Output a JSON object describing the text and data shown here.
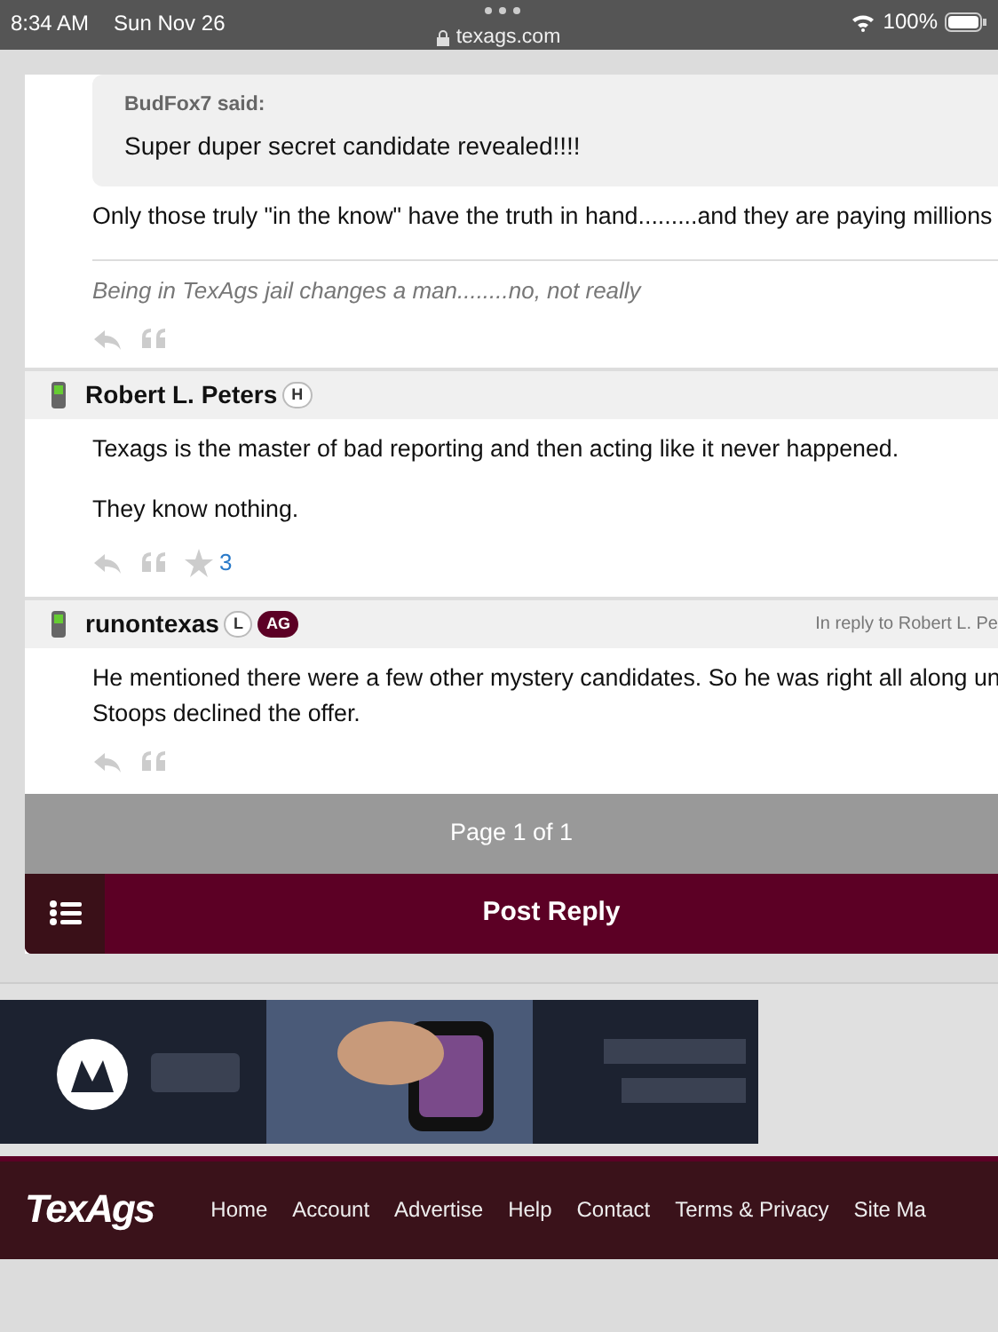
{
  "status_bar": {
    "time": "8:34 AM",
    "date": "Sun Nov 26",
    "url": "texags.com",
    "battery": "100%"
  },
  "first_post": {
    "quote": {
      "author": "BudFox7 said:",
      "text": "Super duper secret candidate revealed!!!!"
    },
    "body": [
      "Only those truly \"in the know\" have the truth in hand.........and they are paying millions"
    ],
    "signature": "Being in TexAgs jail changes a man........no, not really"
  },
  "posts": [
    {
      "author": "Robert L. Peters",
      "badges": [
        {
          "label": "H",
          "kind": "outline"
        }
      ],
      "body": [
        "Texags is the master of bad reporting and then acting like it never happened.",
        "They know nothing."
      ],
      "stars": "3"
    },
    {
      "author": "runontexas",
      "badges": [
        {
          "label": "L",
          "kind": "outline"
        },
        {
          "label": "AG",
          "kind": "filled"
        }
      ],
      "reply_to": "In reply to Robert L. Pe",
      "body": [
        "He mentioned there were a few other mystery candidates. So he was right all along un",
        "Stoops declined the offer."
      ]
    }
  ],
  "pagination": "Page 1 of 1",
  "post_reply": "Post Reply",
  "footer": {
    "logo": "TexAgs",
    "links": [
      "Home",
      "Account",
      "Advertise",
      "Help",
      "Contact",
      "Terms & Privacy",
      "Site Ma"
    ]
  }
}
